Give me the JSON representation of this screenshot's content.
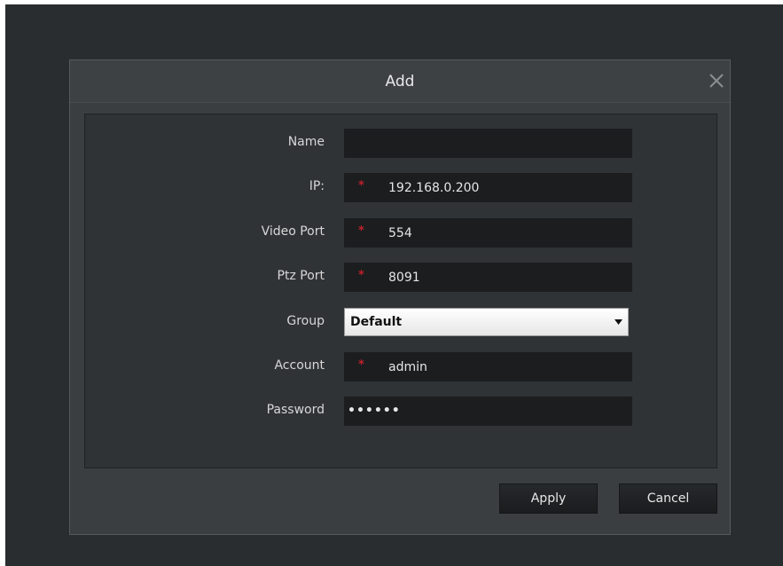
{
  "dialog": {
    "title": "Add"
  },
  "form": {
    "name": {
      "label": "Name",
      "value": ""
    },
    "ip": {
      "label": "IP:",
      "value": "192.168.0.200",
      "required_mark": "*"
    },
    "video_port": {
      "label": "Video Port",
      "value": "554",
      "required_mark": "*"
    },
    "ptz_port": {
      "label": "Ptz Port",
      "value": "8091",
      "required_mark": "*"
    },
    "group": {
      "label": "Group",
      "value": "Default"
    },
    "account": {
      "label": "Account",
      "value": "admin",
      "required_mark": "*"
    },
    "password": {
      "label": "Password",
      "value": "••••••"
    }
  },
  "buttons": {
    "apply": "Apply",
    "cancel": "Cancel"
  },
  "colors": {
    "backdrop": "#2a2d30",
    "dialog_bg": "#3b3e41",
    "panel_bg": "#303336",
    "field_bg": "#1b1d1f",
    "required": "#c0202a"
  },
  "icons": {
    "close": "close-icon",
    "dropdown": "chevron-down-icon"
  }
}
